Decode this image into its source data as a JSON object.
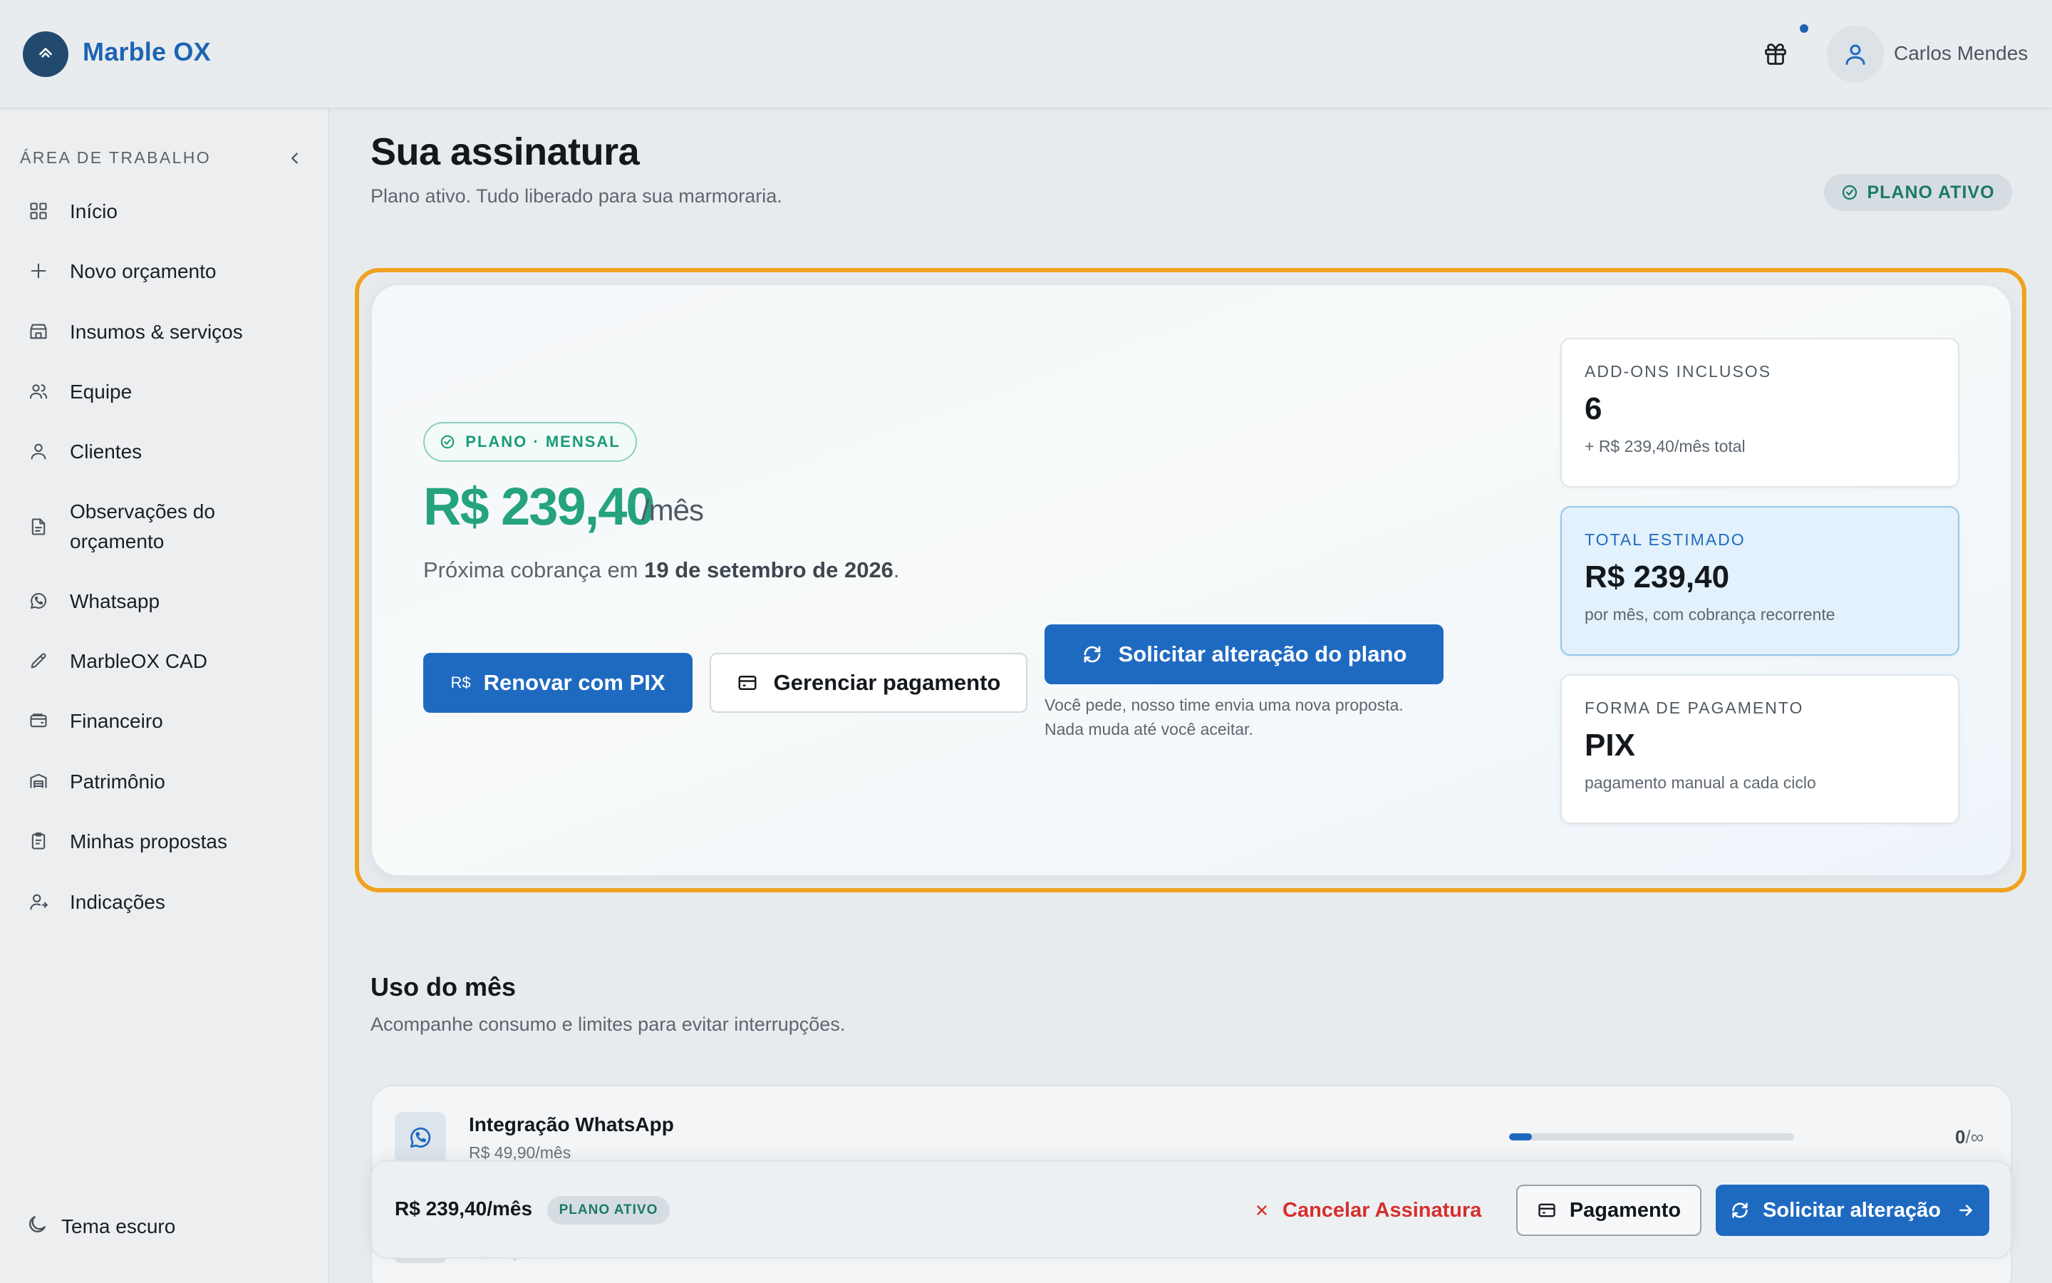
{
  "header": {
    "brand": "Marble OX",
    "user_name": "Carlos Mendes"
  },
  "sidebar": {
    "section_label": "ÁREA DE TRABALHO",
    "items": [
      {
        "label": "Início",
        "icon": "grid-icon"
      },
      {
        "label": "Novo orçamento",
        "icon": "plus-icon"
      },
      {
        "label": "Insumos & serviços",
        "icon": "store-icon"
      },
      {
        "label": "Equipe",
        "icon": "users-icon"
      },
      {
        "label": "Clientes",
        "icon": "user-icon"
      },
      {
        "label_line1": "Observações do",
        "label_line2": "orçamento",
        "icon": "file-text-icon"
      },
      {
        "label": "Whatsapp",
        "icon": "whatsapp-icon"
      },
      {
        "label": "MarbleOX CAD",
        "icon": "pencil-icon"
      },
      {
        "label": "Financeiro",
        "icon": "wallet-icon"
      },
      {
        "label": "Patrimônio",
        "icon": "warehouse-icon"
      },
      {
        "label": "Minhas propostas",
        "icon": "clipboard-icon"
      },
      {
        "label": "Indicações",
        "icon": "user-share-icon"
      }
    ],
    "theme_toggle": "Tema escuro"
  },
  "page": {
    "title": "Sua assinatura",
    "subtitle": "Plano ativo. Tudo liberado para sua marmoraria.",
    "status_pill": "PLANO ATIVO"
  },
  "plan": {
    "badge": "PLANO · MENSAL",
    "price": "R$ 239,40",
    "price_unit": "/mês",
    "next_charge_prefix": "Próxima cobrança em ",
    "next_charge_date": "19 de setembro de 2026",
    "next_charge_suffix": ".",
    "btn_renew_currency": "R$",
    "btn_renew": "Renovar com PIX",
    "btn_manage": "Gerenciar pagamento",
    "btn_change": "Solicitar alteração do plano",
    "change_note_line1": "Você pede, nosso time envia uma nova proposta.",
    "change_note_line2": "Nada muda até você aceitar."
  },
  "stats": [
    {
      "label": "ADD-ONS INCLUSOS",
      "value": "6",
      "sub": "+ R$ 239,40/mês total"
    },
    {
      "label": "TOTAL ESTIMADO",
      "value": "R$ 239,40",
      "sub": "por mês, com cobrança recorrente"
    },
    {
      "label": "FORMA DE PAGAMENTO",
      "value": "PIX",
      "sub": "pagamento manual a cada ciclo"
    }
  ],
  "usage": {
    "title": "Uso do mês",
    "subtitle": "Acompanhe consumo e limites para evitar interrupções.",
    "items": [
      {
        "name": "Integração WhatsApp",
        "price": "R$ 49,90/mês",
        "used": "0",
        "limit": "/∞",
        "fill_percent": 8
      },
      {
        "price": "R$ 49,90/mês"
      }
    ]
  },
  "bottom_bar": {
    "price": "R$ 239,40/mês",
    "pill": "PLANO ATIVO",
    "cancel": "Cancelar Assinatura",
    "payment": "Pagamento",
    "change": "Solicitar alteração"
  },
  "colors": {
    "primary": "#1f6ac1",
    "brand": "#1d64b3",
    "success": "#24a37e",
    "danger": "#d62f2f",
    "highlight": "#f0a21f"
  }
}
